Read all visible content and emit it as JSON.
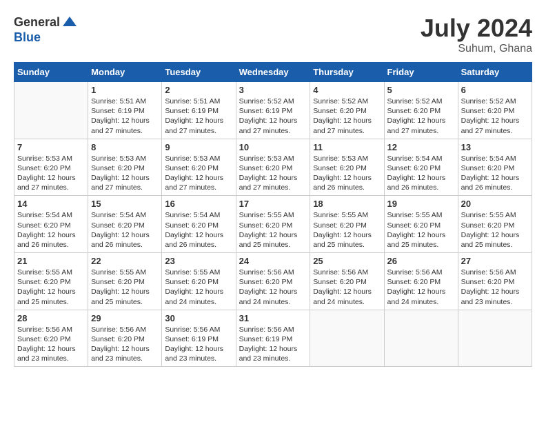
{
  "header": {
    "logo": {
      "general": "General",
      "blue": "Blue"
    },
    "title": "July 2024",
    "location": "Suhum, Ghana"
  },
  "days_of_week": [
    "Sunday",
    "Monday",
    "Tuesday",
    "Wednesday",
    "Thursday",
    "Friday",
    "Saturday"
  ],
  "weeks": [
    [
      {
        "day": "",
        "info": ""
      },
      {
        "day": "1",
        "info": "Sunrise: 5:51 AM\nSunset: 6:19 PM\nDaylight: 12 hours and 27 minutes."
      },
      {
        "day": "2",
        "info": "Sunrise: 5:51 AM\nSunset: 6:19 PM\nDaylight: 12 hours and 27 minutes."
      },
      {
        "day": "3",
        "info": "Sunrise: 5:52 AM\nSunset: 6:19 PM\nDaylight: 12 hours and 27 minutes."
      },
      {
        "day": "4",
        "info": "Sunrise: 5:52 AM\nSunset: 6:20 PM\nDaylight: 12 hours and 27 minutes."
      },
      {
        "day": "5",
        "info": "Sunrise: 5:52 AM\nSunset: 6:20 PM\nDaylight: 12 hours and 27 minutes."
      },
      {
        "day": "6",
        "info": "Sunrise: 5:52 AM\nSunset: 6:20 PM\nDaylight: 12 hours and 27 minutes."
      }
    ],
    [
      {
        "day": "7",
        "info": "Sunrise: 5:53 AM\nSunset: 6:20 PM\nDaylight: 12 hours and 27 minutes."
      },
      {
        "day": "8",
        "info": "Sunrise: 5:53 AM\nSunset: 6:20 PM\nDaylight: 12 hours and 27 minutes."
      },
      {
        "day": "9",
        "info": "Sunrise: 5:53 AM\nSunset: 6:20 PM\nDaylight: 12 hours and 27 minutes."
      },
      {
        "day": "10",
        "info": "Sunrise: 5:53 AM\nSunset: 6:20 PM\nDaylight: 12 hours and 27 minutes."
      },
      {
        "day": "11",
        "info": "Sunrise: 5:53 AM\nSunset: 6:20 PM\nDaylight: 12 hours and 26 minutes."
      },
      {
        "day": "12",
        "info": "Sunrise: 5:54 AM\nSunset: 6:20 PM\nDaylight: 12 hours and 26 minutes."
      },
      {
        "day": "13",
        "info": "Sunrise: 5:54 AM\nSunset: 6:20 PM\nDaylight: 12 hours and 26 minutes."
      }
    ],
    [
      {
        "day": "14",
        "info": "Sunrise: 5:54 AM\nSunset: 6:20 PM\nDaylight: 12 hours and 26 minutes."
      },
      {
        "day": "15",
        "info": "Sunrise: 5:54 AM\nSunset: 6:20 PM\nDaylight: 12 hours and 26 minutes."
      },
      {
        "day": "16",
        "info": "Sunrise: 5:54 AM\nSunset: 6:20 PM\nDaylight: 12 hours and 26 minutes."
      },
      {
        "day": "17",
        "info": "Sunrise: 5:55 AM\nSunset: 6:20 PM\nDaylight: 12 hours and 25 minutes."
      },
      {
        "day": "18",
        "info": "Sunrise: 5:55 AM\nSunset: 6:20 PM\nDaylight: 12 hours and 25 minutes."
      },
      {
        "day": "19",
        "info": "Sunrise: 5:55 AM\nSunset: 6:20 PM\nDaylight: 12 hours and 25 minutes."
      },
      {
        "day": "20",
        "info": "Sunrise: 5:55 AM\nSunset: 6:20 PM\nDaylight: 12 hours and 25 minutes."
      }
    ],
    [
      {
        "day": "21",
        "info": "Sunrise: 5:55 AM\nSunset: 6:20 PM\nDaylight: 12 hours and 25 minutes."
      },
      {
        "day": "22",
        "info": "Sunrise: 5:55 AM\nSunset: 6:20 PM\nDaylight: 12 hours and 25 minutes."
      },
      {
        "day": "23",
        "info": "Sunrise: 5:55 AM\nSunset: 6:20 PM\nDaylight: 12 hours and 24 minutes."
      },
      {
        "day": "24",
        "info": "Sunrise: 5:56 AM\nSunset: 6:20 PM\nDaylight: 12 hours and 24 minutes."
      },
      {
        "day": "25",
        "info": "Sunrise: 5:56 AM\nSunset: 6:20 PM\nDaylight: 12 hours and 24 minutes."
      },
      {
        "day": "26",
        "info": "Sunrise: 5:56 AM\nSunset: 6:20 PM\nDaylight: 12 hours and 24 minutes."
      },
      {
        "day": "27",
        "info": "Sunrise: 5:56 AM\nSunset: 6:20 PM\nDaylight: 12 hours and 23 minutes."
      }
    ],
    [
      {
        "day": "28",
        "info": "Sunrise: 5:56 AM\nSunset: 6:20 PM\nDaylight: 12 hours and 23 minutes."
      },
      {
        "day": "29",
        "info": "Sunrise: 5:56 AM\nSunset: 6:20 PM\nDaylight: 12 hours and 23 minutes."
      },
      {
        "day": "30",
        "info": "Sunrise: 5:56 AM\nSunset: 6:19 PM\nDaylight: 12 hours and 23 minutes."
      },
      {
        "day": "31",
        "info": "Sunrise: 5:56 AM\nSunset: 6:19 PM\nDaylight: 12 hours and 23 minutes."
      },
      {
        "day": "",
        "info": ""
      },
      {
        "day": "",
        "info": ""
      },
      {
        "day": "",
        "info": ""
      }
    ]
  ]
}
